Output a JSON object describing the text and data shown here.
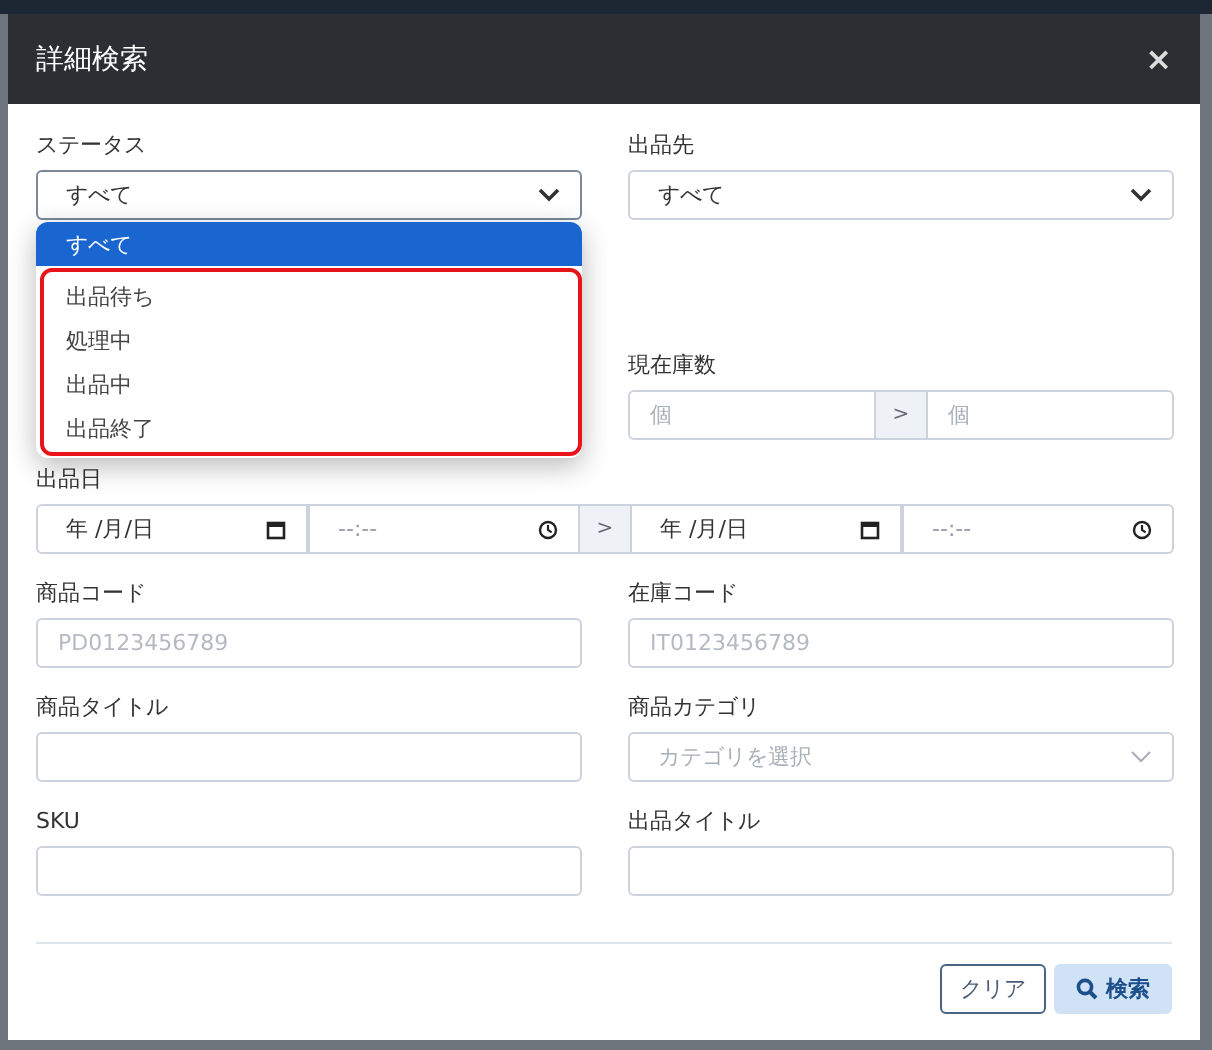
{
  "dialog": {
    "title": "詳細検索",
    "close": "×"
  },
  "status": {
    "label": "ステータス",
    "value": "すべて",
    "options": [
      {
        "label": "すべて",
        "selected": true,
        "highlighted": false
      },
      {
        "label": "出品待ち",
        "selected": false,
        "highlighted": true
      },
      {
        "label": "処理中",
        "selected": false,
        "highlighted": true
      },
      {
        "label": "出品中",
        "selected": false,
        "highlighted": true
      },
      {
        "label": "出品終了",
        "selected": false,
        "highlighted": true
      }
    ]
  },
  "listing_destination": {
    "label": "出品先",
    "value": "すべて"
  },
  "stock_count": {
    "label": "現在庫数",
    "from_placeholder": "個",
    "separator": ">",
    "to_placeholder": "個"
  },
  "listing_date": {
    "label": "出品日",
    "from_date": "年 /月/日",
    "from_time": "--:--",
    "separator": ">",
    "to_date": "年 /月/日",
    "to_time": "--:--"
  },
  "fields": [
    {
      "label": "商品コード",
      "kind": "text",
      "placeholder": "PD0123456789"
    },
    {
      "label": "在庫コード",
      "kind": "text",
      "placeholder": "IT0123456789"
    },
    {
      "label": "商品タイトル",
      "kind": "text"
    },
    {
      "label": "商品カテゴリ",
      "kind": "select",
      "placeholder": "カテゴリを選択"
    },
    {
      "label": "SKU",
      "kind": "text"
    },
    {
      "label": "出品タイトル",
      "kind": "text"
    }
  ],
  "buttons": [
    {
      "label": "クリア",
      "kind": "secondary"
    },
    {
      "label": "検索",
      "kind": "primary"
    }
  ]
}
